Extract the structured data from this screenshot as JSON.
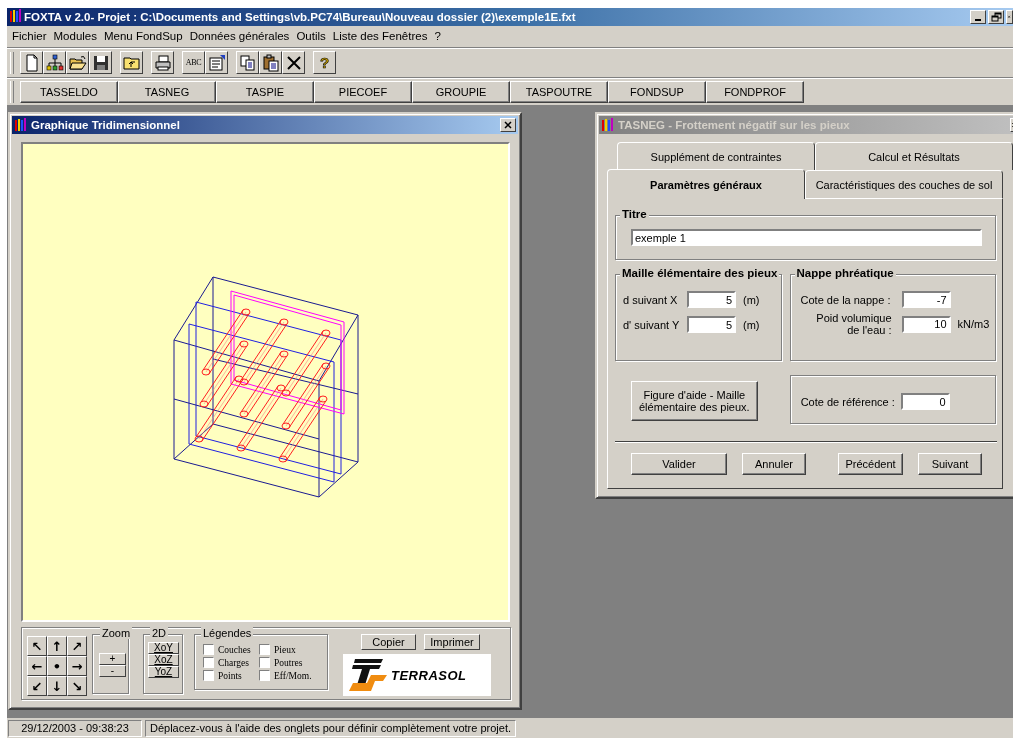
{
  "window": {
    "title": "FOXTA v 2.0- Projet : C:\\Documents and Settings\\vb.PC74\\Bureau\\Nouveau dossier (2)\\exemple1E.fxt"
  },
  "menu": [
    "Fichier",
    "Modules",
    "Menu FondSup",
    "Données générales",
    "Outils",
    "Liste des Fenêtres",
    "?"
  ],
  "toolbar": [
    [
      {
        "kind": "new"
      },
      {
        "kind": "tree"
      },
      {
        "kind": "open"
      },
      {
        "kind": "save"
      }
    ],
    [
      {
        "kind": "up"
      }
    ],
    [
      {
        "kind": "print"
      }
    ],
    [
      {
        "kind": "spell",
        "label": "ABC"
      },
      {
        "kind": "props"
      }
    ],
    [
      {
        "kind": "copy"
      },
      {
        "kind": "paste"
      },
      {
        "kind": "delete"
      }
    ],
    [
      {
        "kind": "help",
        "label": "?"
      }
    ]
  ],
  "modules": [
    "TASSELDO",
    "TASNEG",
    "TASPIE",
    "PIECOEF",
    "GROUPIE",
    "TASPOUTRE",
    "FONDSUP",
    "FONDPROF"
  ],
  "graph_window": {
    "title": "Graphique Tridimensionnel",
    "active": true,
    "pad": [
      "↖",
      "↑",
      "↗",
      "←",
      "•",
      "→",
      "↙",
      "↓",
      "↘"
    ],
    "zoom": {
      "label": "Zoom",
      "buttons": [
        "+",
        "-"
      ]
    },
    "view2d": {
      "label": "2D",
      "buttons": [
        "XoY",
        "XoZ",
        "YoZ"
      ]
    },
    "legend": {
      "label": "Légendes",
      "items": [
        {
          "label": "Couches",
          "checked": false
        },
        {
          "label": "Pieux",
          "checked": false
        },
        {
          "label": "Charges",
          "checked": false
        },
        {
          "label": "Poutres",
          "checked": false
        },
        {
          "label": "Points",
          "checked": false
        },
        {
          "label": "Eff/Mom.",
          "checked": false
        }
      ]
    },
    "buttons": [
      "Copier",
      "Imprimer"
    ],
    "logo": "TERRASOL"
  },
  "dialog": {
    "title": "TASNEG - Frottement négatif sur les pieux",
    "active": false,
    "tabs_back": [
      {
        "label": "Supplément de contraintes",
        "selected": false
      },
      {
        "label": "Calcul et Résultats",
        "selected": false
      }
    ],
    "tabs_front": [
      {
        "label": "Paramètres généraux",
        "selected": true
      },
      {
        "label": "Caractéristiques des couches de sol",
        "selected": false
      }
    ],
    "titre": {
      "label": "Titre",
      "value": "exemple 1"
    },
    "maille": {
      "label": "Maille élémentaire des pieux",
      "fields": [
        {
          "label": "d suivant X",
          "value": "5",
          "unit": "(m)"
        },
        {
          "label": "d' suivant Y",
          "value": "5",
          "unit": "(m)"
        }
      ]
    },
    "nappe": {
      "label": "Nappe phréatique",
      "fields": [
        {
          "label": "Cote de la nappe :",
          "value": "-7"
        },
        {
          "label": "Poid volumique de l'eau :",
          "value": "10",
          "unit": "kN/m3"
        }
      ]
    },
    "help_button": "Figure d'aide - Maille élémentaire des pieux.",
    "reference": {
      "label": "Cote de référence :",
      "value": "0"
    },
    "buttons": [
      "Valider",
      "Annuler",
      "Précédent",
      "Suivant"
    ]
  },
  "status_bar": {
    "time": "29/12/2003 - 09:38:23",
    "message": "Déplacez-vous à l'aide des onglets pour définir complètement votre projet."
  }
}
